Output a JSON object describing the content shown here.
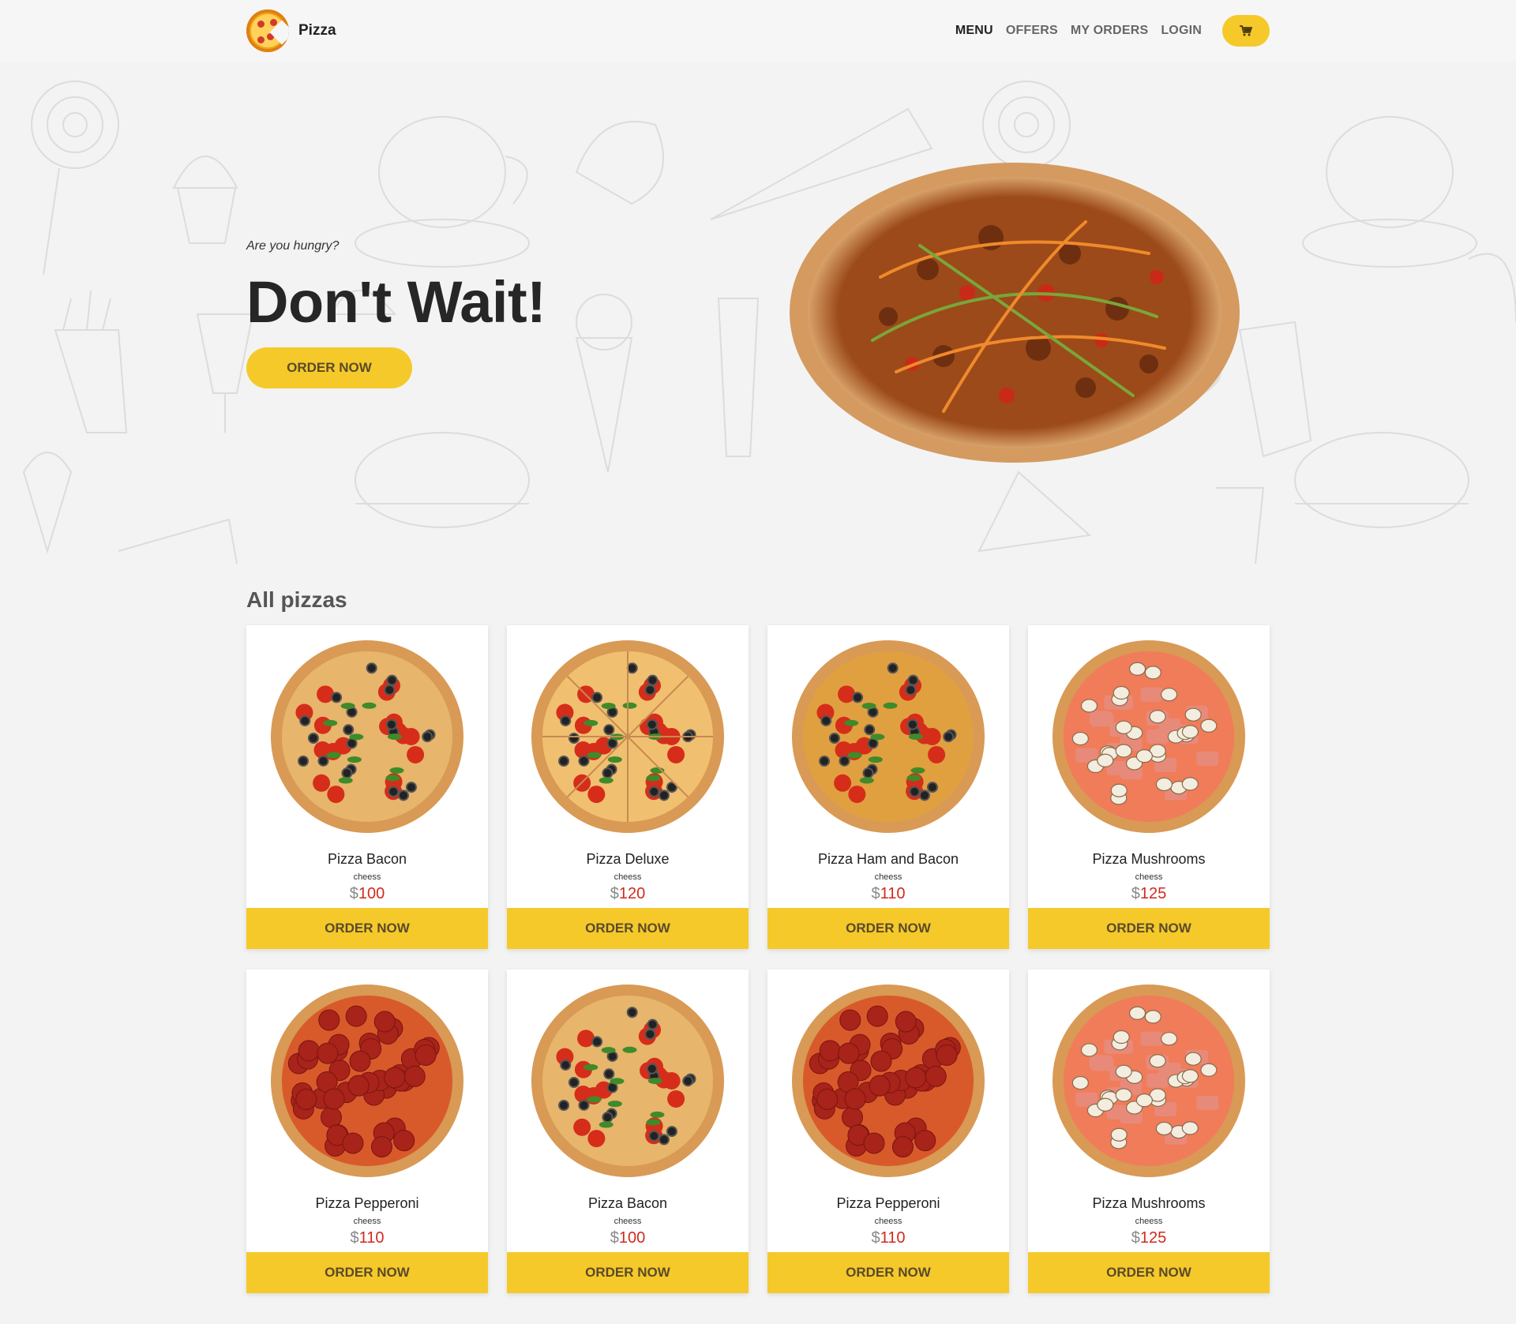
{
  "navbar": {
    "brand": "Pizza",
    "links": [
      "MENU",
      "OFFERS",
      "MY ORDERS",
      "LOGIN"
    ],
    "cart_icon": "shopping-cart-icon"
  },
  "hero": {
    "subtitle": "Are you hungry?",
    "title": "Don't Wait!",
    "button": "ORDER NOW"
  },
  "section": {
    "title": "All pizzas"
  },
  "products": [
    {
      "name": "Pizza Bacon",
      "desc": "cheess",
      "currency": "$",
      "price": "100",
      "button": "ORDER NOW",
      "style": "veggie"
    },
    {
      "name": "Pizza Deluxe",
      "desc": "cheess",
      "currency": "$",
      "price": "120",
      "button": "ORDER NOW",
      "style": "deluxe"
    },
    {
      "name": "Pizza Ham and Bacon",
      "desc": "cheess",
      "currency": "$",
      "price": "110",
      "button": "ORDER NOW",
      "style": "ham"
    },
    {
      "name": "Pizza Mushrooms",
      "desc": "cheess",
      "currency": "$",
      "price": "125",
      "button": "ORDER NOW",
      "style": "mushroom"
    },
    {
      "name": "Pizza Pepperoni",
      "desc": "cheess",
      "currency": "$",
      "price": "110",
      "button": "ORDER NOW",
      "style": "pepperoni"
    },
    {
      "name": "Pizza Bacon",
      "desc": "cheess",
      "currency": "$",
      "price": "100",
      "button": "ORDER NOW",
      "style": "veggie"
    },
    {
      "name": "Pizza Pepperoni",
      "desc": "cheess",
      "currency": "$",
      "price": "110",
      "button": "ORDER NOW",
      "style": "pepperoni"
    },
    {
      "name": "Pizza Mushrooms",
      "desc": "cheess",
      "currency": "$",
      "price": "125",
      "button": "ORDER NOW",
      "style": "mushroom"
    }
  ],
  "colors": {
    "accent": "#f5c92a",
    "price": "#d12a1e",
    "background": "#f3f3f3"
  }
}
